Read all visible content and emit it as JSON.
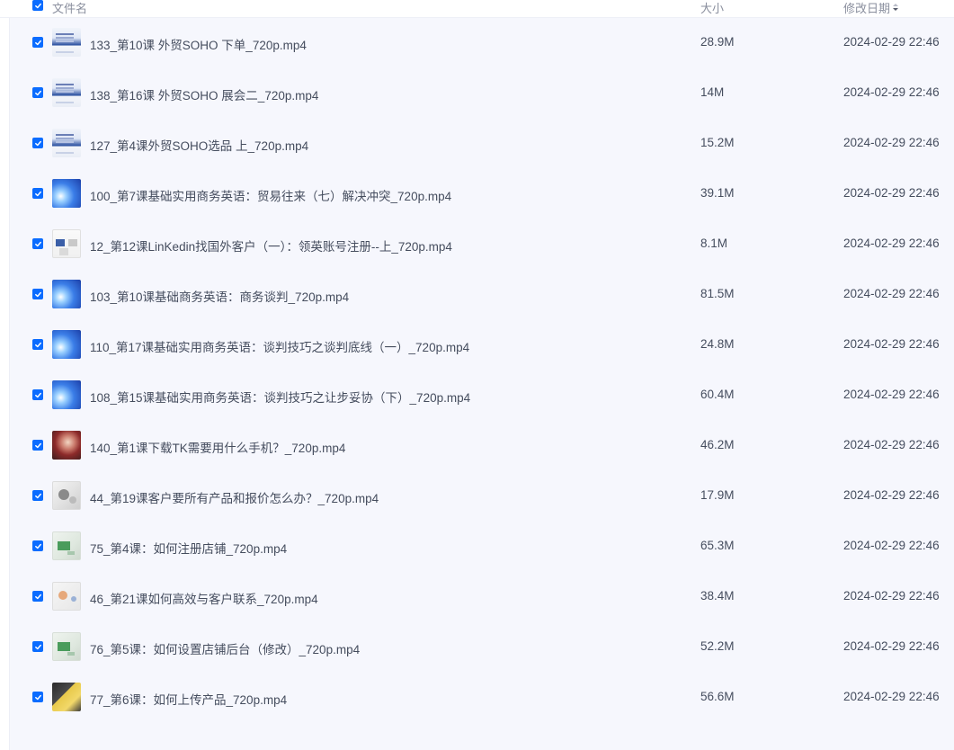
{
  "header": {
    "name_label": "文件名",
    "size_label": "大小",
    "date_label": "修改日期"
  },
  "icons": {
    "checkbox": "checkbox-checked-icon",
    "sort": "sort-desc-icon"
  },
  "colors": {
    "accent": "#0a6cff",
    "text": "#454d5e",
    "header_text": "#8a8f9e",
    "row_background": "#f6f7fd"
  },
  "files": [
    {
      "name": "133_第10课 外贸SOHO 下单_720p.mp4",
      "size": "28.9M",
      "date": "2024-02-29 22:46",
      "thumb": "slide"
    },
    {
      "name": "138_第16课 外贸SOHO 展会二_720p.mp4",
      "size": "14M",
      "date": "2024-02-29 22:46",
      "thumb": "slide"
    },
    {
      "name": "127_第4课外贸SOHO选品 上_720p.mp4",
      "size": "15.2M",
      "date": "2024-02-29 22:46",
      "thumb": "slide"
    },
    {
      "name": "100_第7课基础实用商务英语：贸易往来（七）解决冲突_720p.mp4",
      "size": "39.1M",
      "date": "2024-02-29 22:46",
      "thumb": "blue"
    },
    {
      "name": "12_第12课LinKedin找国外客户（一）：领英账号注册--上_720p.mp4",
      "size": "8.1M",
      "date": "2024-02-29 22:46",
      "thumb": "app"
    },
    {
      "name": "103_第10课基础商务英语：商务谈判_720p.mp4",
      "size": "81.5M",
      "date": "2024-02-29 22:46",
      "thumb": "blue"
    },
    {
      "name": "110_第17课基础实用商务英语：谈判技巧之谈判底线（一）_720p.mp4",
      "size": "24.8M",
      "date": "2024-02-29 22:46",
      "thumb": "blue"
    },
    {
      "name": "108_第15课基础实用商务英语：谈判技巧之让步妥协（下）_720p.mp4",
      "size": "60.4M",
      "date": "2024-02-29 22:46",
      "thumb": "blue"
    },
    {
      "name": "140_第1课下载TK需要用什么手机？_720p.mp4",
      "size": "46.2M",
      "date": "2024-02-29 22:46",
      "thumb": "photo"
    },
    {
      "name": "44_第19课客户要所有产品和报价怎么办？_720p.mp4",
      "size": "17.9M",
      "date": "2024-02-29 22:46",
      "thumb": "screen"
    },
    {
      "name": "75_第4课：如何注册店铺_720p.mp4",
      "size": "65.3M",
      "date": "2024-02-29 22:46",
      "thumb": "green"
    },
    {
      "name": "46_第21课如何高效与客户联系_720p.mp4",
      "size": "38.4M",
      "date": "2024-02-29 22:46",
      "thumb": "face"
    },
    {
      "name": "76_第5课：如何设置店铺后台（修改）_720p.mp4",
      "size": "52.2M",
      "date": "2024-02-29 22:46",
      "thumb": "green"
    },
    {
      "name": "77_第6课：如何上传产品_720p.mp4",
      "size": "56.6M",
      "date": "2024-02-29 22:46",
      "thumb": "yellow"
    }
  ]
}
